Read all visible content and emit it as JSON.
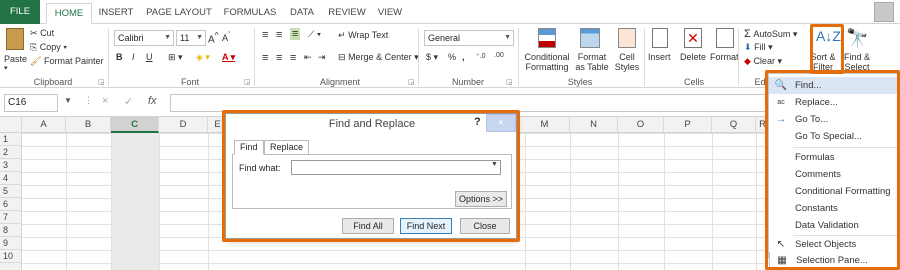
{
  "tabs": [
    "FILE",
    "HOME",
    "INSERT",
    "PAGE LAYOUT",
    "FORMULAS",
    "DATA",
    "REVIEW",
    "VIEW"
  ],
  "clipboard": {
    "paste": "Paste",
    "cut": "Cut",
    "copy": "Copy",
    "format_painter": "Format Painter",
    "group": "Clipboard"
  },
  "font": {
    "name": "Calibri",
    "size": "11",
    "group": "Font",
    "bold": "B",
    "italic": "I",
    "underline": "U"
  },
  "alignment": {
    "wrap_text": "Wrap Text",
    "merge_center": "Merge & Center",
    "group": "Alignment"
  },
  "number": {
    "format": "General",
    "currency": "$",
    "percent": "%",
    "comma": ",",
    "group": "Number"
  },
  "styles": {
    "conditional": "Conditional Formatting",
    "format_table": "Format as Table",
    "cell_styles": "Cell Styles",
    "group": "Styles"
  },
  "cells": {
    "insert": "Insert",
    "delete": "Delete",
    "format": "Format",
    "group": "Cells"
  },
  "editing": {
    "autosum": "AutoSum",
    "fill": "Fill",
    "clear": "Clear",
    "sort_filter": "Sort & Filter",
    "find_select": "Find & Select",
    "group_short": "Ed"
  },
  "formula_bar": {
    "name_box": "C16",
    "fx": "fx",
    "cancel": "×",
    "enter": "✓"
  },
  "columns": [
    "A",
    "B",
    "C",
    "D",
    "E",
    "",
    "",
    "",
    "",
    "",
    "M",
    "N",
    "O",
    "P",
    "Q",
    "R"
  ],
  "rows": [
    "1",
    "2",
    "3",
    "4",
    "5",
    "6",
    "7",
    "8",
    "9",
    "10"
  ],
  "dialog": {
    "title": "Find and Replace",
    "help": "?",
    "close": "×",
    "tab_find": "Find",
    "tab_replace": "Replace",
    "find_what_label": "Find what:",
    "find_what_value": "",
    "options": "Options >>",
    "find_all": "Find All",
    "find_next": "Find Next",
    "close_btn": "Close"
  },
  "menu": [
    {
      "icon": "binoculars-icon",
      "glyph": "🔍",
      "label": "Find..."
    },
    {
      "icon": "replace-icon",
      "glyph": "ac",
      "label": "Replace..."
    },
    {
      "icon": "arrow-right-icon",
      "glyph": "→",
      "label": "Go To..."
    },
    {
      "icon": "",
      "glyph": "",
      "label": "Go To Special..."
    },
    {
      "icon": "",
      "glyph": "",
      "label": "Formulas"
    },
    {
      "icon": "",
      "glyph": "",
      "label": "Comments"
    },
    {
      "icon": "",
      "glyph": "",
      "label": "Conditional Formatting"
    },
    {
      "icon": "",
      "glyph": "",
      "label": "Constants"
    },
    {
      "icon": "",
      "glyph": "",
      "label": "Data Validation"
    },
    {
      "icon": "cursor-icon",
      "glyph": "↖",
      "label": "Select Objects"
    },
    {
      "icon": "selection-pane-icon",
      "glyph": "▦",
      "label": "Selection Pane..."
    }
  ],
  "colors": {
    "excel_green": "#217346",
    "highlight_orange": "#e46c0a",
    "menu_hover": "#dbe6f5"
  }
}
